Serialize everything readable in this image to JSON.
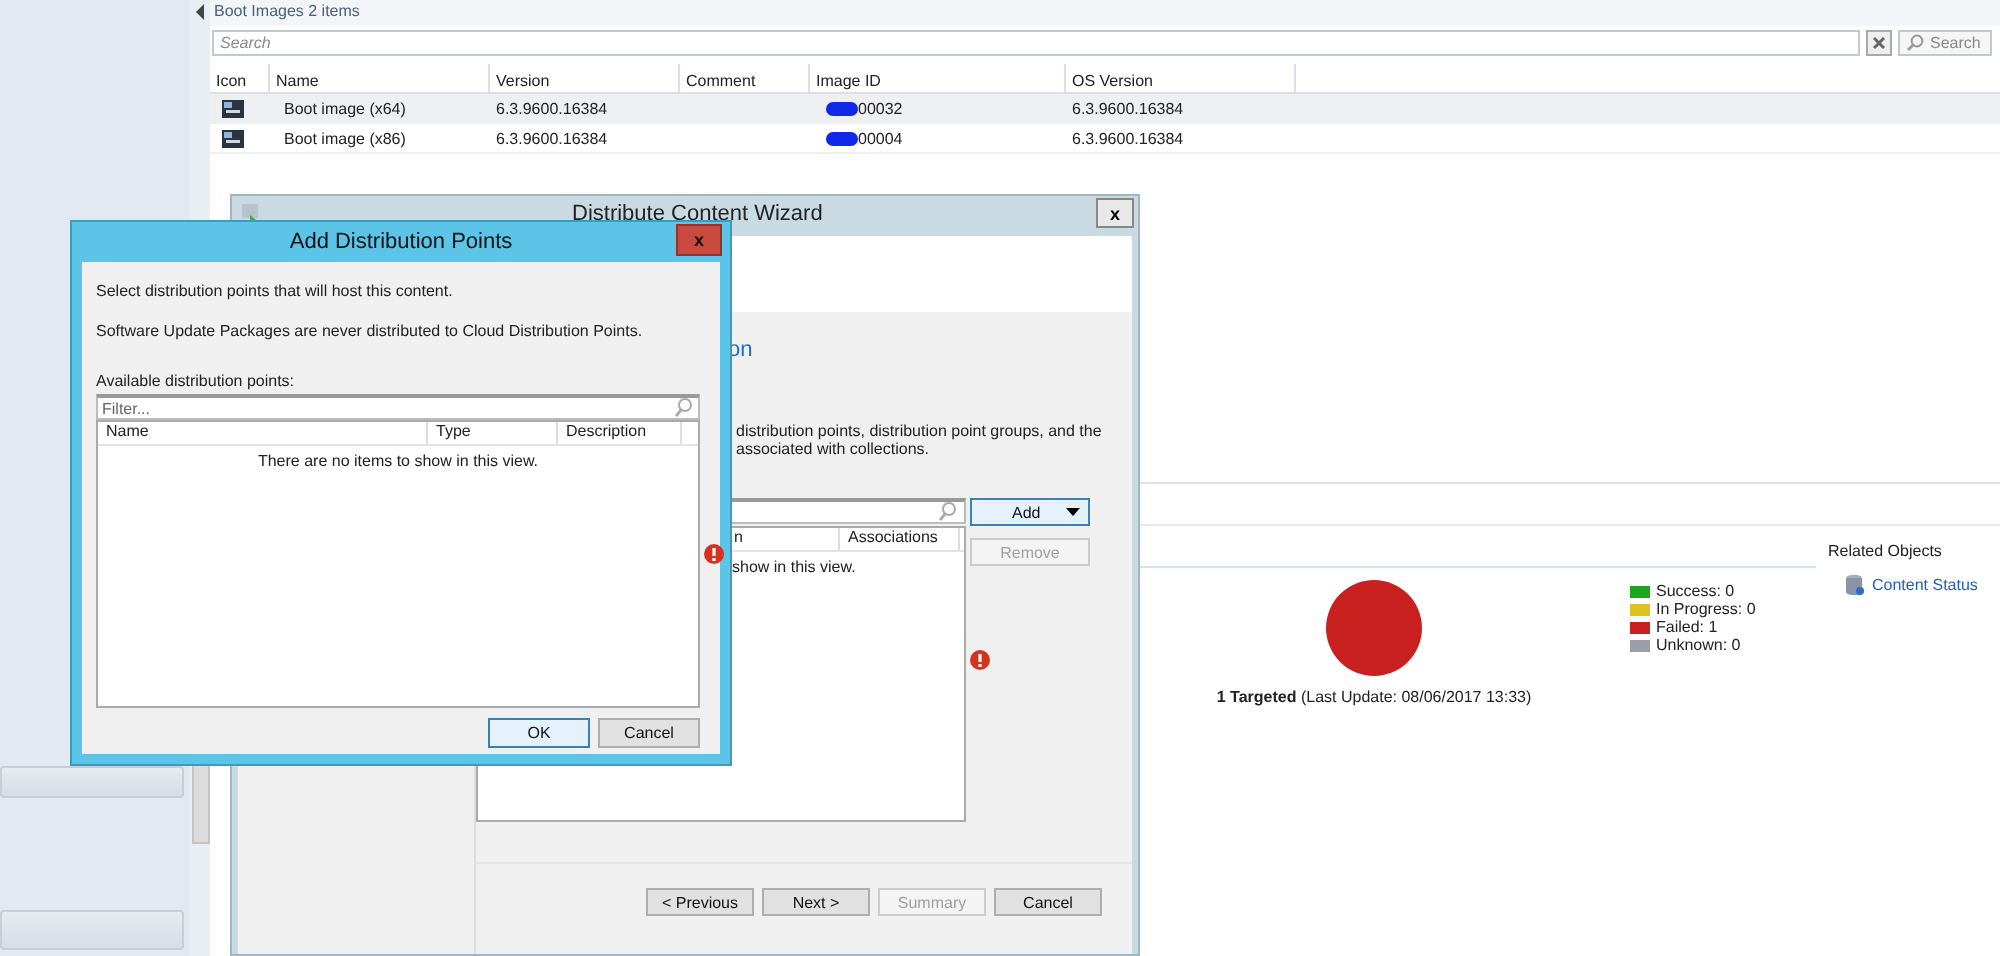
{
  "list_header": {
    "title": "Boot Images 2 items"
  },
  "search": {
    "placeholder": "Search",
    "button": "Search"
  },
  "table": {
    "columns": [
      "Icon",
      "Name",
      "Version",
      "Comment",
      "Image ID",
      "OS Version"
    ],
    "rows": [
      {
        "name": "Boot image (x64)",
        "version": "6.3.9600.16384",
        "comment": "",
        "image_id": "00032",
        "os_version": "6.3.9600.16384",
        "selected": true
      },
      {
        "name": "Boot image (x86)",
        "version": "6.3.9600.16384",
        "comment": "",
        "image_id": "00004",
        "os_version": "6.3.9600.16384",
        "selected": false
      }
    ]
  },
  "details": {
    "summary_bold": "1 Targeted",
    "summary": "(Last Update: 08/06/2017 13:33)",
    "legend": [
      {
        "label": "Success: 0",
        "color": "#1ea51e"
      },
      {
        "label": "In Progress: 0",
        "color": "#e0c21c"
      },
      {
        "label": "Failed: 1",
        "color": "#c8201e"
      },
      {
        "label": "Unknown: 0",
        "color": "#9a9ea6"
      }
    ],
    "related_title": "Related Objects",
    "related_link": "Content Status"
  },
  "wizard": {
    "title": "Distribute Content Wizard",
    "heading": "on",
    "description": [
      "distribution points, distribution point groups, and the",
      "associated with collections."
    ],
    "list_columns": [
      "n",
      "Associations"
    ],
    "list_empty": "show in this view.",
    "add_button": "Add",
    "remove_button": {
      "label": "Remove",
      "disabled": true
    },
    "buttons": [
      {
        "label": "< Previous",
        "disabled": false
      },
      {
        "label": "Next >",
        "disabled": false
      },
      {
        "label": "Summary",
        "disabled": true
      },
      {
        "label": "Cancel",
        "disabled": false
      }
    ]
  },
  "dialog": {
    "title": "Add Distribution Points",
    "close": "x",
    "intro": "Select distribution points that will host this content.",
    "note": "Software Update Packages are never distributed to Cloud Distribution Points.",
    "list_label": "Available distribution points:",
    "filter_placeholder": "Filter...",
    "columns": [
      "Name",
      "Type",
      "Description"
    ],
    "empty": "There are no items to show in this view.",
    "buttons": [
      {
        "label": "OK",
        "default": true
      },
      {
        "label": "Cancel",
        "default": false
      }
    ]
  },
  "wizard_close": "x"
}
